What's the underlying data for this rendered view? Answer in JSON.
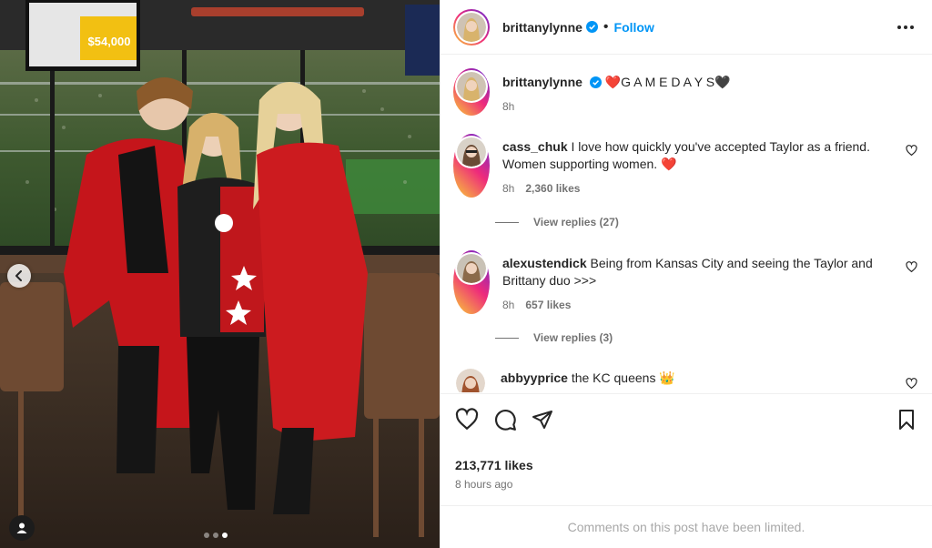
{
  "post": {
    "author": "brittanylynne",
    "follow_label": "Follow",
    "caption": "❤️G A M E D A Y S🖤",
    "caption_time": "8h",
    "likes": "213,771 likes",
    "posted": "8 hours ago",
    "limited_note": "Comments on this post have been limited.",
    "slides": {
      "count": 3,
      "active_index": 3
    },
    "scoreboard": "$54,000"
  },
  "comments": [
    {
      "user": "cass_chuk",
      "text": "I love how quickly you've accepted Taylor as a friend. Women supporting women. ❤️",
      "time": "8h",
      "likes": "2,360 likes",
      "replies": "View replies (27)"
    },
    {
      "user": "alexustendick",
      "text": "Being from Kansas City and seeing the Taylor and Brittany duo >>>",
      "time": "8h",
      "likes": "657 likes",
      "replies": "View replies (3)"
    },
    {
      "user": "abbyyprice",
      "text": "the KC queens 👑"
    }
  ],
  "icons": {
    "like": "heart-icon",
    "comment": "comment-icon",
    "share": "send-icon",
    "save": "bookmark-icon",
    "options": "more-icon",
    "verified": "verified-badge-icon",
    "prev": "chevron-left-icon",
    "tagged": "user-tag-icon"
  },
  "colors": {
    "accent": "#0095f6",
    "text": "#262626",
    "muted": "#737373",
    "verified": "#0095f6"
  }
}
